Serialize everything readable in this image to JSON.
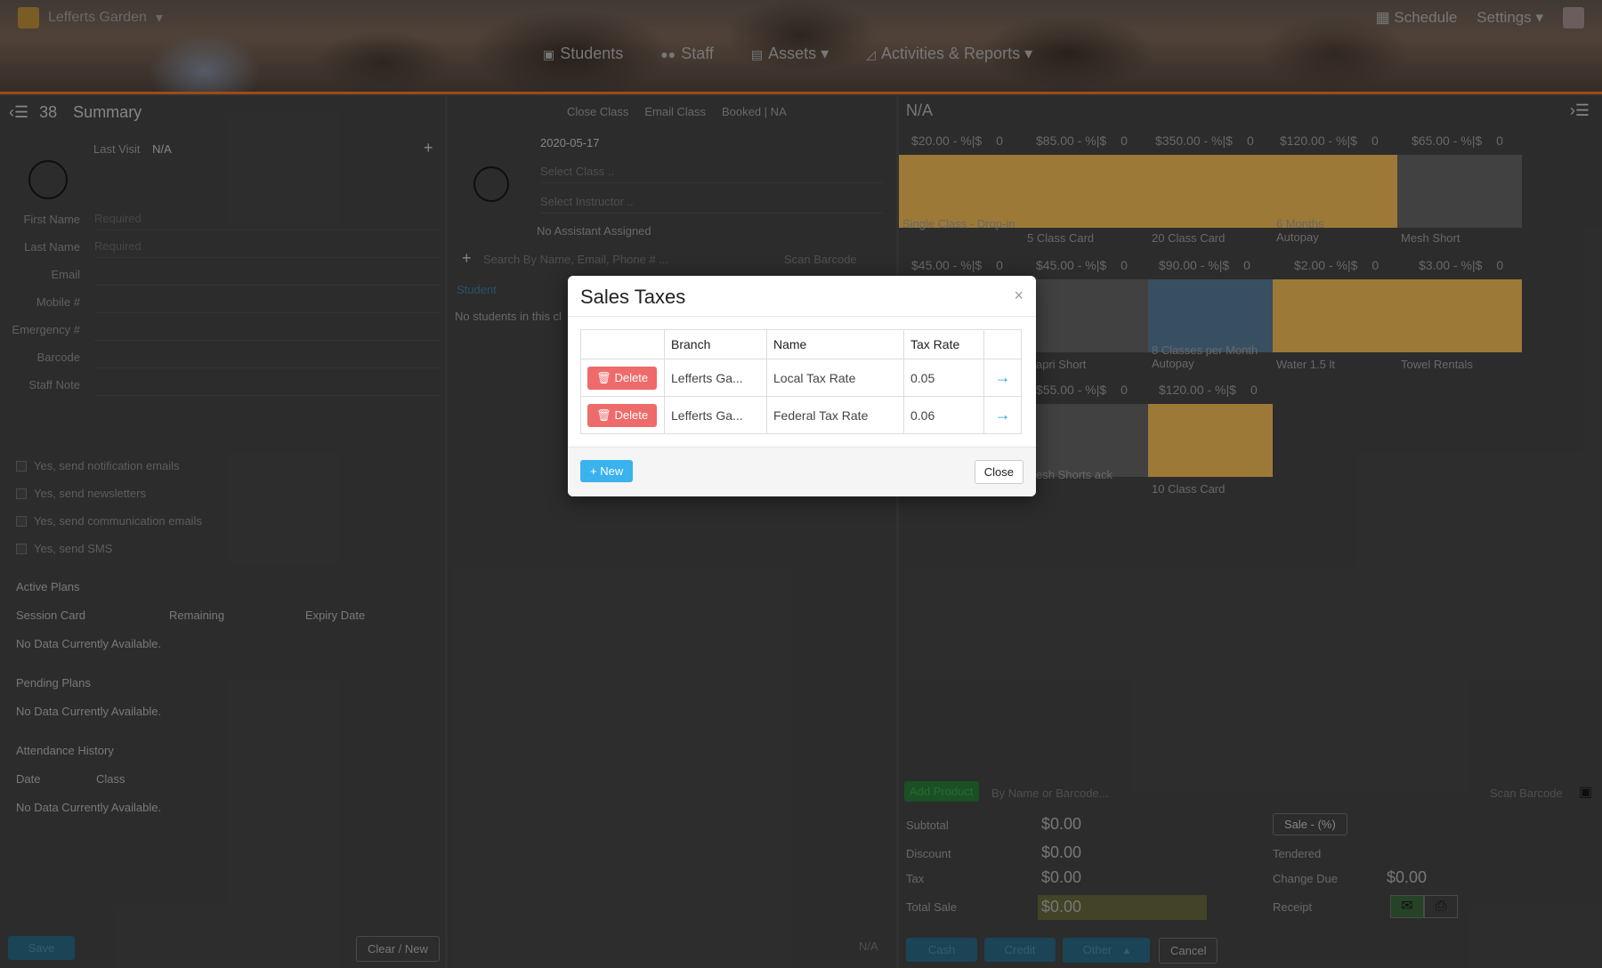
{
  "header": {
    "brand": "Lefferts Garden",
    "schedule": "Schedule",
    "settings": "Settings",
    "nav": [
      "Students",
      "Staff",
      "Assets",
      "Activities & Reports"
    ]
  },
  "left_panel": {
    "count": "38",
    "title": "Summary",
    "last_visit_label": "Last Visit",
    "last_visit_value": "N/A",
    "fields": [
      {
        "label": "First Name",
        "value": "Required"
      },
      {
        "label": "Last Name",
        "value": "Required"
      },
      {
        "label": "Email",
        "value": ""
      },
      {
        "label": "Mobile #",
        "value": ""
      },
      {
        "label": "Emergency #",
        "value": ""
      },
      {
        "label": "Barcode",
        "value": ""
      },
      {
        "label": "Staff Note",
        "value": ""
      }
    ],
    "checkboxes": [
      "Yes, send notification emails",
      "Yes, send newsletters",
      "Yes, send communication emails",
      "Yes, send SMS"
    ],
    "active_plans": "Active Plans",
    "plan_cols": [
      "Session Card",
      "Remaining",
      "Expiry Date"
    ],
    "no_data": "No Data Currently Available.",
    "pending_plans": "Pending Plans",
    "attendance": "Attendance History",
    "att_cols": [
      "Date",
      "Class"
    ],
    "save": "Save",
    "clear_new": "Clear / New"
  },
  "mid_panel": {
    "tabs": [
      "Close Class",
      "Email Class",
      "Booked | NA"
    ],
    "date": "2020-05-17",
    "select_class": "Select Class ..",
    "select_instructor": "Select Instructor ..",
    "no_assistant": "No Assistant Assigned",
    "search_placeholder": "Search By Name, Email, Phone # ...",
    "scan_barcode": "Scan Barcode",
    "student_col": "Student",
    "no_students": "No students in this cl",
    "na": "N/A"
  },
  "right_panel": {
    "title": "N/A",
    "tiles_row1": [
      {
        "price": "$20.00",
        "label": "Single Class - Drop-in"
      },
      {
        "price": "$85.00",
        "label": "5 Class Card"
      },
      {
        "price": "$350.00",
        "label": "20 Class Card"
      },
      {
        "price": "$120.00",
        "label": "6 Months Autopay"
      },
      {
        "price": "$65.00",
        "label": "Mesh Short"
      }
    ],
    "tiles_row2": [
      {
        "price": "$45.00",
        "label": ""
      },
      {
        "price": "$45.00",
        "label": "apri Short"
      },
      {
        "price": "$90.00",
        "label": "8 Classes per Month Autopay"
      },
      {
        "price": "$2.00",
        "label": "Water 1.5 lt"
      },
      {
        "price": "$3.00",
        "label": "Towel Rentals"
      }
    ],
    "tiles_row3": [
      {
        "price": "$55.00",
        "label": "esh Shorts ack"
      },
      {
        "price": "$120.00",
        "label": "10 Class Card"
      }
    ],
    "price_suffix": "- %|$",
    "qty": "0",
    "add_product": "Add Product",
    "by_name": "By Name or Barcode...",
    "scan_barcode": "Scan Barcode",
    "subtotal_label": "Subtotal",
    "subtotal": "$0.00",
    "discount_label": "Discount",
    "discount": "$0.00",
    "tax_label": "Tax",
    "tax": "$0.00",
    "total_label": "Total Sale",
    "total": "$0.00",
    "sale_btn": "Sale - (%)",
    "tendered": "Tendered",
    "change_due_label": "Change Due",
    "change_due": "$0.00",
    "receipt": "Receipt",
    "cash": "Cash",
    "credit": "Credit",
    "other": "Other",
    "cancel": "Cancel"
  },
  "modal": {
    "title": "Sales Taxes",
    "close_x": "×",
    "columns": [
      "",
      "Branch",
      "Name",
      "Tax Rate",
      ""
    ],
    "rows": [
      {
        "action": "Delete",
        "branch": "Lefferts Ga...",
        "name": "Local Tax Rate",
        "rate": "0.05"
      },
      {
        "action": "Delete",
        "branch": "Lefferts Ga...",
        "name": "Federal Tax Rate",
        "rate": "0.06"
      }
    ],
    "new_btn": "New",
    "close_btn": "Close"
  },
  "colors": {
    "accent": "#3ab2ee",
    "danger": "#ef6b6b",
    "link": "#2b9fd9",
    "tile": "#b28a3e"
  }
}
